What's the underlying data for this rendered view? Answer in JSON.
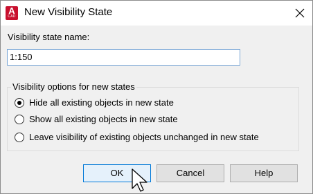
{
  "window": {
    "title": "New Visibility State",
    "app_icon": {
      "letter": "A",
      "caption": "CAD",
      "color": "#c8102e"
    }
  },
  "name_field": {
    "label": "Visibility state name:",
    "value": "1:150"
  },
  "options_group": {
    "legend": "Visibility options for new states",
    "options": [
      {
        "label": "Hide all existing objects in new state",
        "selected": true
      },
      {
        "label": "Show all existing objects in new state",
        "selected": false
      },
      {
        "label": "Leave visibility of existing objects unchanged in new state",
        "selected": false
      }
    ]
  },
  "buttons": {
    "ok": "OK",
    "cancel": "Cancel",
    "help": "Help"
  },
  "colors": {
    "default_button_border": "#0078d7",
    "input_border": "#7aa7d6"
  }
}
